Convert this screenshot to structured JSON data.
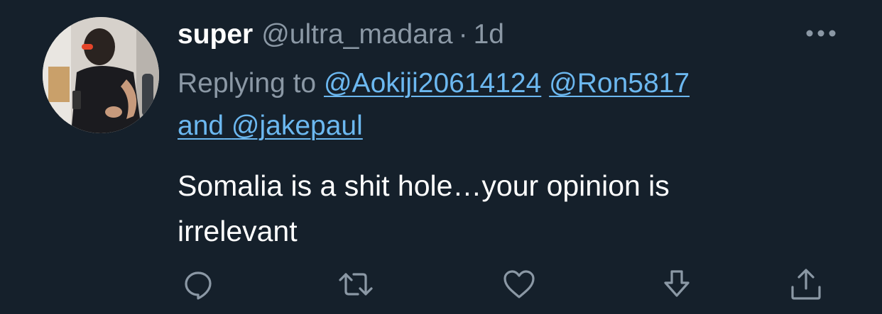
{
  "tweet": {
    "display_name": "super",
    "handle": "@ultra_madara",
    "separator": "·",
    "time": "1d",
    "replying_prefix": "Replying to",
    "mentions": [
      "@Aokiji20614124",
      "@Ron5817",
      "@jakepaul"
    ],
    "mentions_joiner": "and",
    "text_line1": "Somalia is a shit hole…your opinion is",
    "text_line2": "irrelevant"
  },
  "icons": {
    "more": "more-horizontal-icon",
    "reply": "reply-icon",
    "retweet": "retweet-icon",
    "like": "heart-icon",
    "download": "download-icon",
    "share": "share-icon"
  },
  "colors": {
    "background": "#15202b",
    "primary_text": "#ffffff",
    "secondary_text": "#8b98a5",
    "link": "#6cb8f0"
  }
}
